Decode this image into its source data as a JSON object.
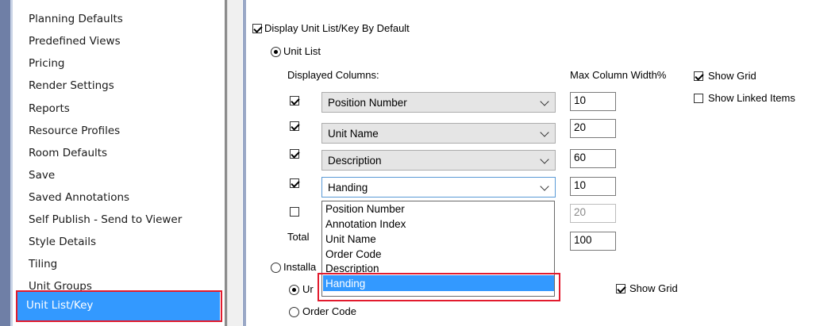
{
  "sidebar": {
    "items": [
      {
        "label": "Planning Defaults"
      },
      {
        "label": "Predefined Views"
      },
      {
        "label": "Pricing"
      },
      {
        "label": "Render Settings"
      },
      {
        "label": "Reports"
      },
      {
        "label": "Resource Profiles"
      },
      {
        "label": "Room Defaults"
      },
      {
        "label": "Save"
      },
      {
        "label": "Saved Annotations"
      },
      {
        "label": "Self Publish - Send to Viewer"
      },
      {
        "label": "Style Details"
      },
      {
        "label": "Tiling"
      },
      {
        "label": "Unit Groups"
      }
    ],
    "selected": {
      "label": "Unit List/Key"
    }
  },
  "settings": {
    "display_default": {
      "label": "Display Unit List/Key By Default",
      "checked": true
    },
    "unit_list_radio": {
      "label": "Unit List",
      "selected": true
    },
    "displayed_columns_label": "Displayed Columns:",
    "max_width_label": "Max Column Width%",
    "show_grid": {
      "label": "Show Grid",
      "checked": true
    },
    "show_linked": {
      "label": "Show Linked Items",
      "checked": false
    },
    "columns": [
      {
        "checked": true,
        "value": "Position Number",
        "width": "10"
      },
      {
        "checked": true,
        "value": "Unit Name",
        "width": "20"
      },
      {
        "checked": true,
        "value": "Description",
        "width": "60"
      },
      {
        "checked": true,
        "value": "Handing",
        "width": "10"
      },
      {
        "checked": false,
        "value": "",
        "width": "20"
      }
    ],
    "total_label": "Total ",
    "total_value": "100",
    "install_radio": {
      "label": "Installa",
      "selected": false
    },
    "sub_radio_unit": {
      "label": "Ur",
      "selected": true
    },
    "sub_radio_order": {
      "label": "Order Code",
      "selected": false
    },
    "show_grid_2": {
      "label": "Show Grid",
      "checked": true
    }
  },
  "dropdown": {
    "options": [
      "Position Number",
      "Annotation Index",
      "Unit Name",
      "Order Code",
      "Description",
      "Handing"
    ],
    "selected": "Handing"
  }
}
